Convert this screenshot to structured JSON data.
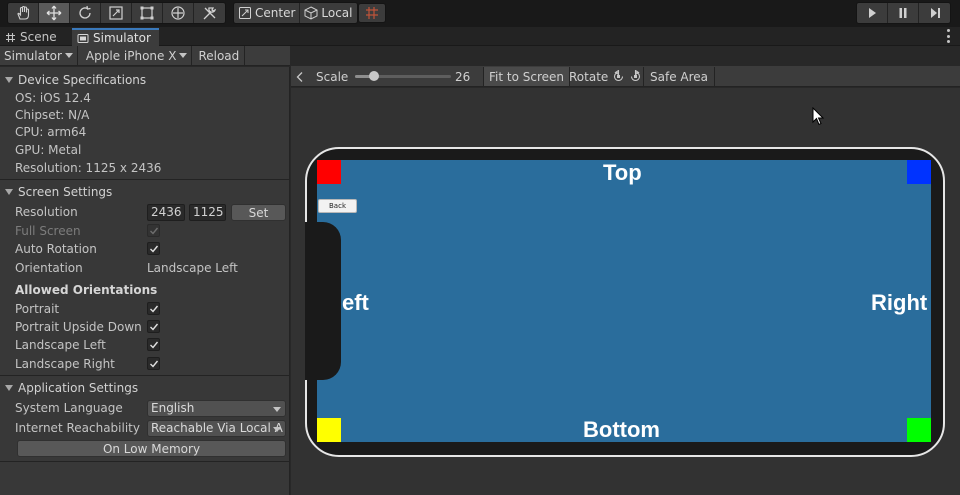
{
  "toolbar": {
    "tools": [
      {
        "icon": "hand-icon"
      },
      {
        "icon": "move-icon"
      },
      {
        "icon": "rotate-icon"
      },
      {
        "icon": "scale-icon"
      },
      {
        "icon": "rect-transform-icon"
      },
      {
        "icon": "transform-icon"
      },
      {
        "icon": "custom-tool-icon"
      }
    ],
    "pivot_label": "Center",
    "space_label": "Local"
  },
  "tabs": {
    "scene": "Scene",
    "simulator": "Simulator"
  },
  "subbar": {
    "mode_label": "Simulator",
    "device_label": "Apple iPhone X",
    "reload_label": "Reload"
  },
  "device_specs": {
    "title": "Device Specifications",
    "os": "OS: iOS 12.4",
    "chipset": "Chipset: N/A",
    "cpu": "CPU: arm64",
    "gpu": "GPU: Metal",
    "resolution": "Resolution: 1125 x 2436"
  },
  "screen_settings": {
    "title": "Screen Settings",
    "resolution_label": "Resolution",
    "width_value": "2436",
    "height_value": "1125",
    "set_label": "Set",
    "full_screen_label": "Full Screen",
    "auto_rotation_label": "Auto Rotation",
    "orientation_label": "Orientation",
    "orientation_value": "Landscape Left",
    "allowed_title": "Allowed Orientations",
    "portrait_label": "Portrait",
    "portrait_upside_label": "Portrait Upside Down",
    "landscape_left_label": "Landscape Left",
    "landscape_right_label": "Landscape Right"
  },
  "app_settings": {
    "title": "Application Settings",
    "language_label": "System Language",
    "language_value": "English",
    "reachability_label": "Internet Reachability",
    "reachability_value": "Reachable Via Local A",
    "low_memory_label": "On Low Memory"
  },
  "sim_toolbar": {
    "scale_label": "Scale",
    "scale_value": "26",
    "scale_fraction": 0.2,
    "fit_label": "Fit to Screen",
    "rotate_label": "Rotate",
    "safe_area_label": "Safe Area"
  },
  "game_screen": {
    "top_label": "Top",
    "left_label": "eft",
    "right_label": "Right",
    "bottom_label": "Bottom",
    "back_label": "Back",
    "corner_colors": {
      "top_left": "#ff0000",
      "top_right": "#0033ff",
      "bottom_left": "#ffff00",
      "bottom_right": "#00ff00"
    },
    "screen_color": "#2a6d9c"
  },
  "colors": {
    "tab_accent": "#3a79bb"
  }
}
